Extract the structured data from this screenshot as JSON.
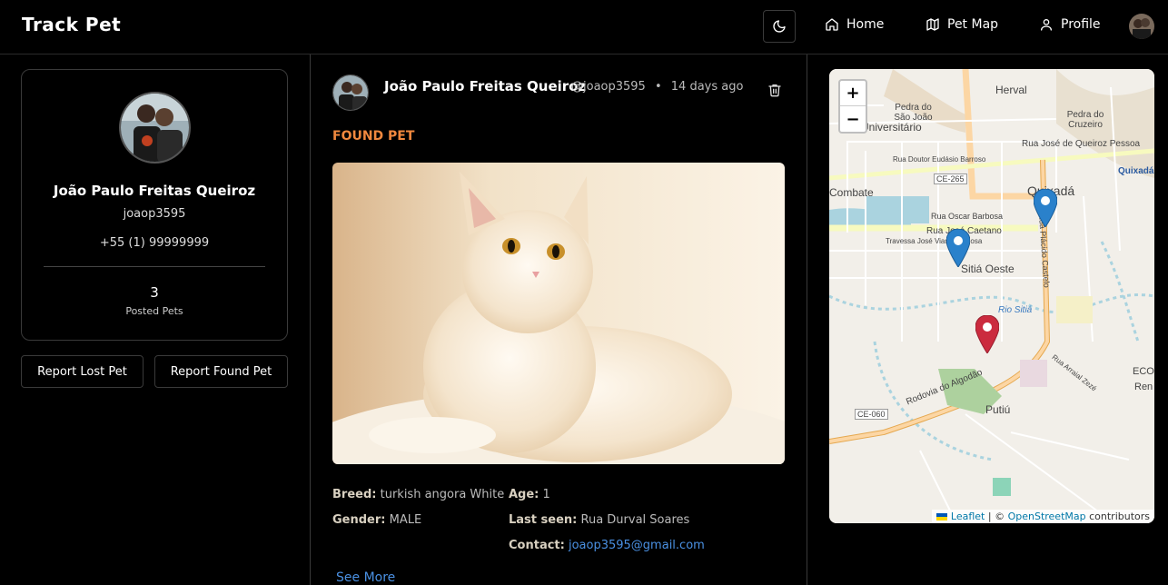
{
  "nav": {
    "brand": "Track Pet",
    "theme_icon": "moon-icon",
    "links": [
      {
        "label": "Home",
        "icon": "home-icon"
      },
      {
        "label": "Pet Map",
        "icon": "map-icon"
      },
      {
        "label": "Profile",
        "icon": "user-icon"
      }
    ]
  },
  "profile": {
    "name": "João Paulo Freitas Queiroz",
    "username": "joaop3595",
    "phone": "+55 (1) 99999999",
    "posted_count": "3",
    "posted_label": "Posted Pets"
  },
  "actions": {
    "report_lost": "Report Lost Pet",
    "report_found": "Report Found Pet"
  },
  "post": {
    "author": "João Paulo Freitas Queiroz",
    "handle": "@joaop3595",
    "separator": "•",
    "time": "14 days ago",
    "type": "FOUND PET",
    "breed_label": "Breed:",
    "breed": "turkish angora White",
    "gender_label": "Gender:",
    "gender": "MALE",
    "age_label": "Age:",
    "age": "1",
    "last_seen_label": "Last seen:",
    "last_seen": "Rua Durval Soares",
    "contact_label": "Contact:",
    "contact": "joaop3595@gmail.com",
    "see_more": "See More"
  },
  "map": {
    "zoom_in": "+",
    "zoom_out": "−",
    "attribution_leaflet": "Leaflet",
    "attribution_sep": " | © ",
    "attribution_osm": "OpenStreetMap",
    "attribution_tail": " contributors",
    "labels": {
      "herval": "Herval",
      "pedra_sao_joao": "Pedra do São João",
      "pedra_cruzeiro": "Pedra do Cruzeiro",
      "universitario": "Universitário",
      "jose_queiroz": "Rua José de Queiroz Pessoa",
      "quixada": "Quixadá",
      "quixada_blue": "Quixadá",
      "eudasio": "Rua Doutor Eudásio Barroso",
      "ce265": "CE-265",
      "combate": "Combate",
      "oscar": "Rua Oscar Barbosa",
      "jose_caetano": "Rua José Caetano",
      "travessa": "Travessa José Viana Barbosa",
      "sitia": "Sitiá Oeste",
      "placido": "Rua Plácido Castelo",
      "rio_sitia": "Rio Sitiá",
      "algodao": "Rodovia do Algodão",
      "arraial": "Rua Arraial Zezé",
      "ce060": "CE-060",
      "putiu": "Putiú",
      "ecoli": "ECOLI",
      "ren": "Ren"
    }
  }
}
